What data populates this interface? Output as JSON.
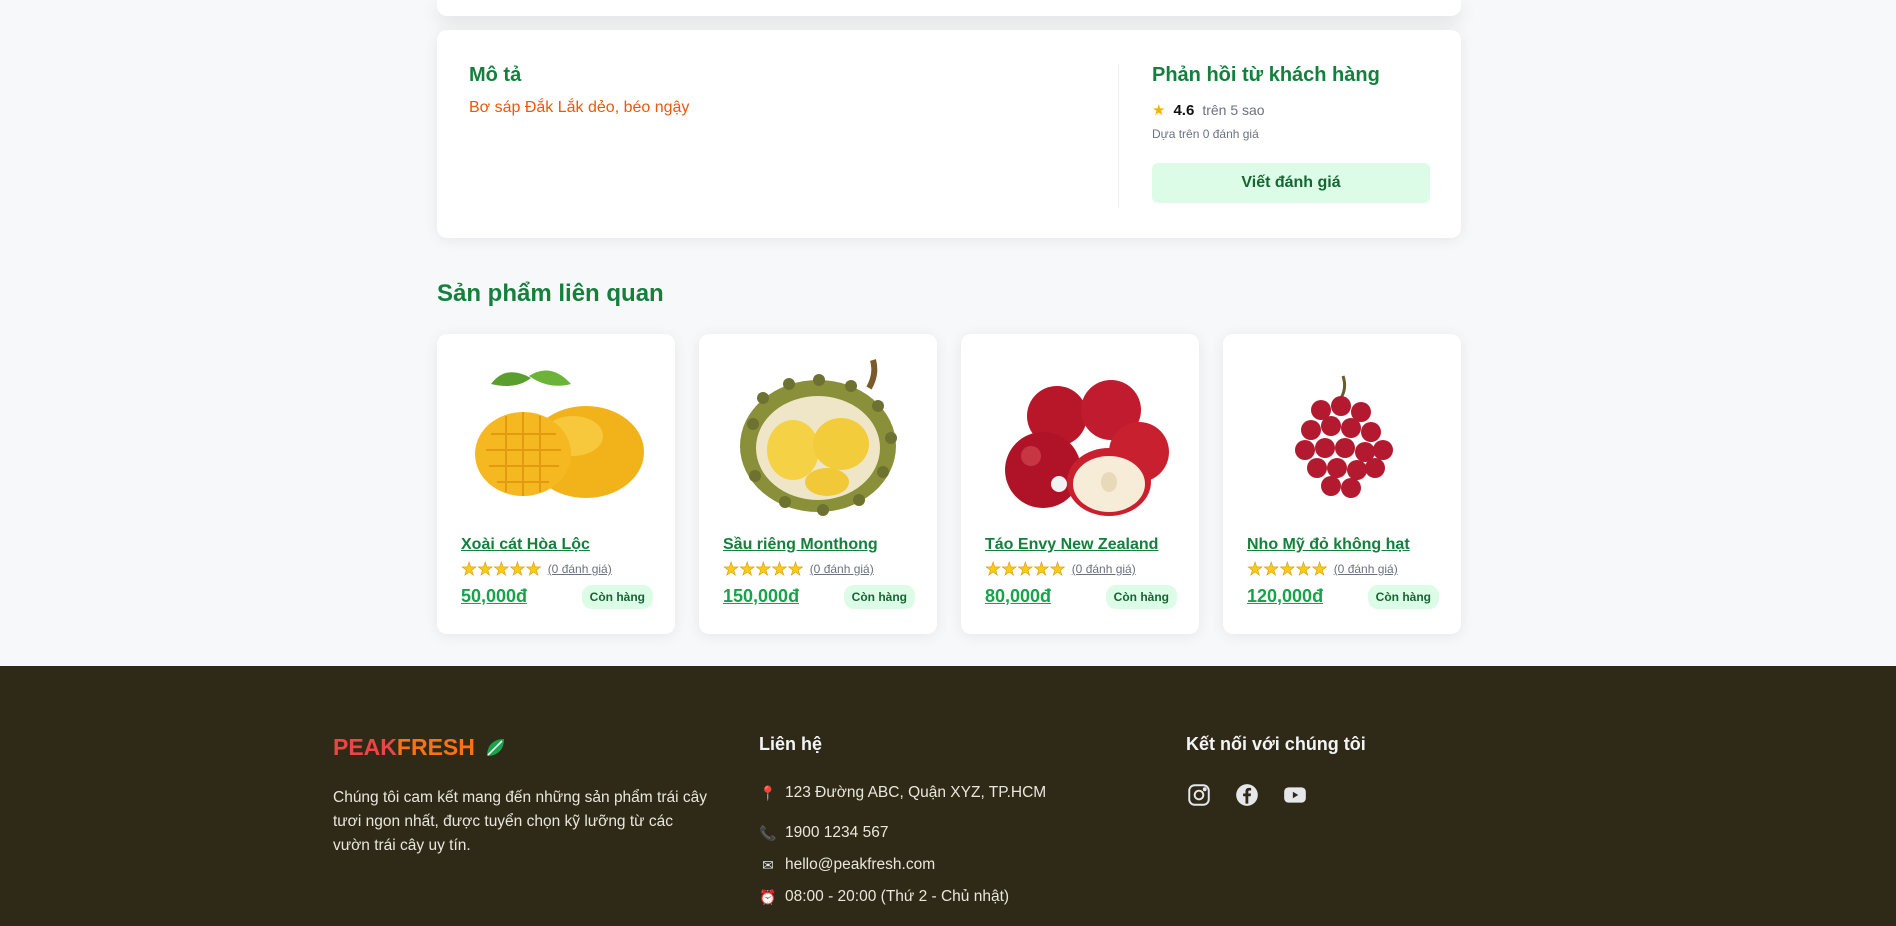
{
  "description": {
    "title": "Mô tả",
    "text": "Bơ sáp Đắk Lắk dẻo, béo ngậy"
  },
  "feedback": {
    "title": "Phản hồi từ khách hàng",
    "score": "4.6",
    "out_of": "trên 5 sao",
    "based_on": "Dựa trên 0 đánh giá",
    "button_label": "Viết đánh giá"
  },
  "related": {
    "title": "Sản phẩm liên quan",
    "products": [
      {
        "name": "Xoài cát Hòa Lộc",
        "stars": "★★★★★",
        "reviews": "(0 đánh giá)",
        "price": "50,000đ",
        "stock": "Còn hàng",
        "image": "mango-image"
      },
      {
        "name": "Sầu riêng Monthong",
        "stars": "★★★★★",
        "reviews": "(0 đánh giá)",
        "price": "150,000đ",
        "stock": "Còn hàng",
        "image": "durian-image"
      },
      {
        "name": "Táo Envy New Zealand",
        "stars": "★★★★★",
        "reviews": "(0 đánh giá)",
        "price": "80,000đ",
        "stock": "Còn hàng",
        "image": "apple-image"
      },
      {
        "name": "Nho Mỹ đỏ không hạt",
        "stars": "★★★★★",
        "reviews": "(0 đánh giá)",
        "price": "120,000đ",
        "stock": "Còn hàng",
        "image": "grape-image"
      }
    ]
  },
  "footer": {
    "logo_part1": "PEAK",
    "logo_part2": "FRESH",
    "about": "Chúng tôi cam kết mang đến những sản phẩm trái cây tươi ngon nhất, được tuyển chọn kỹ lưỡng từ các vườn trái cây uy tín.",
    "contact_title": "Liên hệ",
    "address": "123 Đường ABC, Quận XYZ, TP.HCM",
    "phone": "1900 1234 567",
    "email": "hello@peakfresh.com",
    "hours": "08:00 - 20:00 (Thứ 2 - Chủ nhật)",
    "social_title": "Kết nối với chúng tôi",
    "social_icons": [
      "instagram-icon",
      "facebook-icon",
      "youtube-icon"
    ]
  },
  "colors": {
    "primary_green": "#15803d",
    "accent_orange": "#ea580c",
    "footer_bg": "#2f2a17",
    "badge_bg": "#dcfce7",
    "star": "#facc15"
  }
}
